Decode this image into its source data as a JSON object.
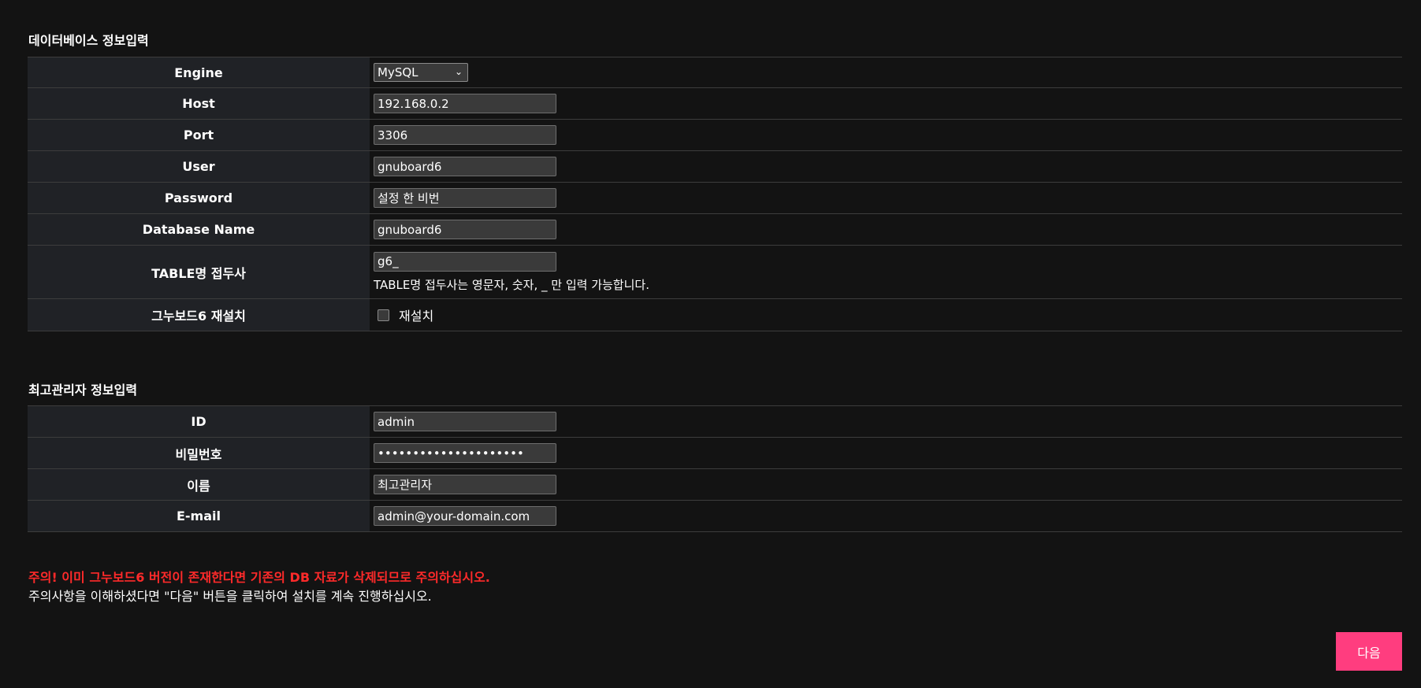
{
  "database_section": {
    "title": "데이터베이스 정보입력",
    "engine": {
      "label": "Engine",
      "selected": "MySQL"
    },
    "host": {
      "label": "Host",
      "value": "192.168.0.2"
    },
    "port": {
      "label": "Port",
      "value": "3306"
    },
    "user": {
      "label": "User",
      "value": "gnuboard6"
    },
    "password": {
      "label": "Password",
      "value": "설정 한 비번"
    },
    "database_name": {
      "label": "Database Name",
      "value": "gnuboard6"
    },
    "table_prefix": {
      "label": "TABLE명 접두사",
      "value": "g6_",
      "help": "TABLE명 접두사는 영문자, 숫자, _ 만 입력 가능합니다."
    },
    "reinstall": {
      "label": "그누보드6 재설치",
      "checkbox_label": "재설치",
      "checked": false
    }
  },
  "admin_section": {
    "title": "최고관리자 정보입력",
    "id": {
      "label": "ID",
      "value": "admin"
    },
    "password": {
      "label": "비밀번호",
      "value": "•••••••••••••••••••••"
    },
    "name": {
      "label": "이름",
      "value": "최고관리자"
    },
    "email": {
      "label": "E-mail",
      "value": "admin@your-domain.com"
    }
  },
  "notice": {
    "warning": "주의! 이미 그누보드6 버전이 존재한다면 기존의 DB 자료가 삭제되므로 주의하십시오.",
    "info": "주의사항을 이해하셨다면 \"다음\" 버튼을 클릭하여 설치를 계속 진행하십시오."
  },
  "next_button": {
    "label": "다음"
  },
  "colors": {
    "background": "#131313",
    "header_cell": "#202226",
    "warning": "#ff2a2a",
    "accent_button": "#ff3d7f"
  }
}
